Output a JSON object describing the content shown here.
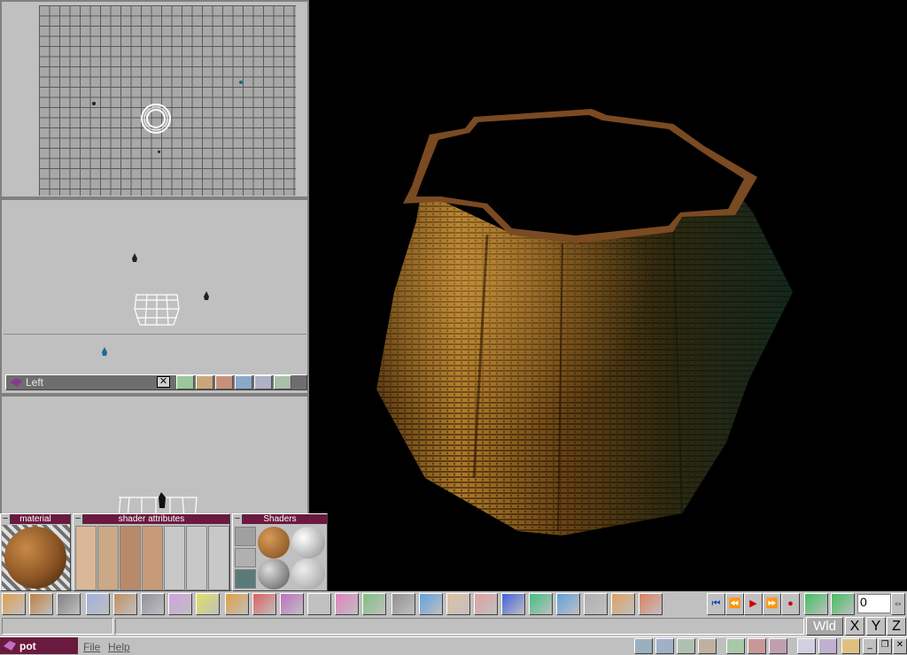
{
  "viewports": {
    "top_view": {},
    "left_view": {
      "title": "Left"
    },
    "front_view": {}
  },
  "render_view": {
    "object": "pot"
  },
  "panels": {
    "material": {
      "title": "material"
    },
    "shader_attributes": {
      "title": "shader attributes"
    },
    "shaders": {
      "title": "Shaders"
    }
  },
  "toolbar": {
    "frame_value": "0",
    "icons": [
      "objects-icon",
      "box-icon",
      "camera-icon",
      "select-arrow-icon",
      "move-icon",
      "plane-icon",
      "wire-box-icon",
      "torus-icon",
      "sphere-icon",
      "color-wheel-icon",
      "molecule-icon",
      "path-icon",
      "funnel-icon",
      "cube-icon",
      "grid-icon",
      "blue-cube-icon",
      "figure-icon",
      "axes-icon",
      "blue-grid-icon",
      "landscape-icon",
      "3d-text-icon",
      "terrain-icon",
      "rotate-icon",
      "snap-icon"
    ],
    "playback": [
      "first-frame-icon",
      "rewind-icon",
      "play-icon",
      "fast-forward-icon",
      "record-icon"
    ]
  },
  "status": {
    "mode": "Wld",
    "axes": [
      "X",
      "Y",
      "Z"
    ]
  },
  "taskbar": {
    "app_title": "pot",
    "menu": [
      "File",
      "Help"
    ]
  },
  "colors": {
    "panel_header": "#6a1a3e",
    "viewport_bg": "#c0c0c0",
    "render_bg": "#000000"
  }
}
